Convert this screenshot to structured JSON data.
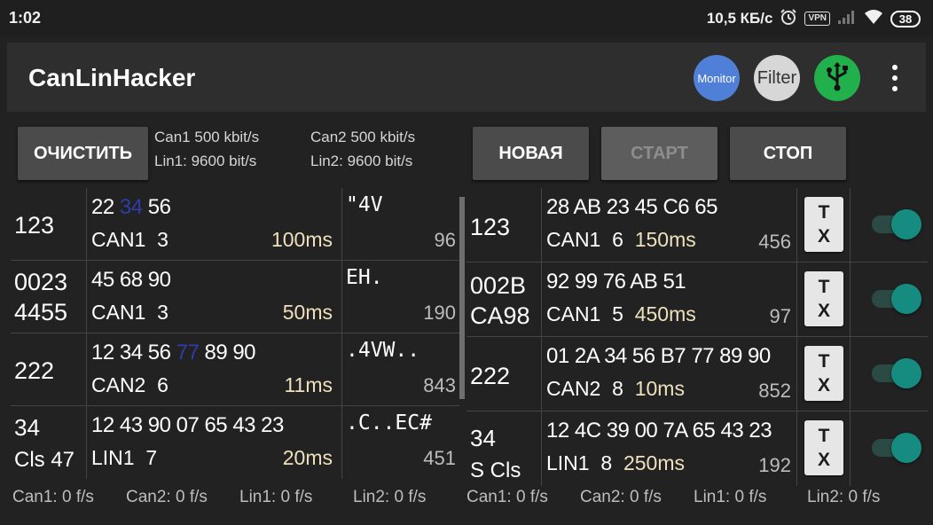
{
  "status_bar": {
    "time": "1:02",
    "network_speed": "10,5 КБ/с",
    "vpn_label": "VPN",
    "battery": "38",
    "icons": [
      "alarm-icon",
      "vpn-icon",
      "signal-icon",
      "wifi-icon",
      "battery-icon"
    ]
  },
  "app_bar": {
    "title": "CanLinHacker",
    "monitor_label": "Monitor",
    "filter_label": "Filter",
    "usb_icon": "usb-icon",
    "menu_icon": "more-vert-icon",
    "colors": {
      "monitor": "#4f7fd6",
      "filter": "#d7d7d7",
      "usb": "#21b04b"
    }
  },
  "controls": {
    "clear_label": "ОЧИСТИТЬ",
    "new_label": "НОВАЯ",
    "start_label": "СТАРТ",
    "stop_label": "СТОП",
    "can1_speed": "Can1 500 kbit/s",
    "lin1_speed": "Lin1: 9600 bit/s",
    "can2_speed": "Can2 500 kbit/s",
    "lin2_speed": "Lin2: 9600 bit/s"
  },
  "monitor_rows": [
    {
      "id_line1": "123",
      "id_line2": "",
      "bytes_pre": "22 ",
      "bytes_hl": "34",
      "bytes_post": " 56",
      "bus": "CAN1",
      "dlc": "3",
      "period": "100ms",
      "ascii": "\"4V",
      "count": "96"
    },
    {
      "id_line1": "0023",
      "id_line2": "4455",
      "bytes_pre": "45 68 90",
      "bytes_hl": "",
      "bytes_post": "",
      "bus": "CAN1",
      "dlc": "3",
      "period": "50ms",
      "ascii": "EH.",
      "count": "190"
    },
    {
      "id_line1": "222",
      "id_line2": "",
      "bytes_pre": "12 34 56 ",
      "bytes_hl": "77",
      "bytes_post": " 89 90",
      "bus": "CAN2",
      "dlc": "6",
      "period": "11ms",
      "ascii": ".4VW..",
      "count": "843"
    },
    {
      "id_line1": "34",
      "id_line2": "Cls 47",
      "bytes_pre": "12 43 90 07 65 43 23",
      "bytes_hl": "",
      "bytes_post": "",
      "bus": "LIN1",
      "dlc": "7",
      "period": "20ms",
      "ascii": ".C..EC#",
      "count": "451"
    }
  ],
  "transmit_rows": [
    {
      "id_line1": "123",
      "id_line2": "",
      "bytes": "28 AB 23 45 C6 65",
      "bus": "CAN1",
      "dlc": "6",
      "period": "150ms",
      "count": "456",
      "tx_line1": "T",
      "tx_line2": "X",
      "enabled": true
    },
    {
      "id_line1": "002B",
      "id_line2": "CA98",
      "bytes": "92 99 76 AB 51",
      "bus": "CAN1",
      "dlc": "5",
      "period": "450ms",
      "count": "97",
      "tx_line1": "T",
      "tx_line2": "X",
      "enabled": true
    },
    {
      "id_line1": "222",
      "id_line2": "",
      "bytes": "01 2A 34 56 B7 77 89 90",
      "bus": "CAN2",
      "dlc": "8",
      "period": "10ms",
      "count": "852",
      "tx_line1": "T",
      "tx_line2": "X",
      "enabled": true
    },
    {
      "id_line1": "34",
      "id_line2": "S Cls",
      "bytes": "12 4C 39 00 7A 65 43 23",
      "bus": "LIN1",
      "dlc": "8",
      "period": "250ms",
      "count": "192",
      "tx_line1": "T",
      "tx_line2": "X",
      "enabled": true
    }
  ],
  "footer_left": {
    "can1": "Can1: 0 f/s",
    "can2": "Can2: 0 f/s",
    "lin1": "Lin1: 0 f/s",
    "lin2": "Lin2: 0 f/s"
  },
  "footer_right": {
    "can1": "Can1: 0 f/s",
    "can2": "Can2: 0 f/s",
    "lin1": "Lin1: 0 f/s",
    "lin2": "Lin2: 0 f/s"
  },
  "colors": {
    "accent_toggle": "#168c80",
    "period_text": "#efe0bd",
    "highlight_byte": "#2f3cab"
  }
}
